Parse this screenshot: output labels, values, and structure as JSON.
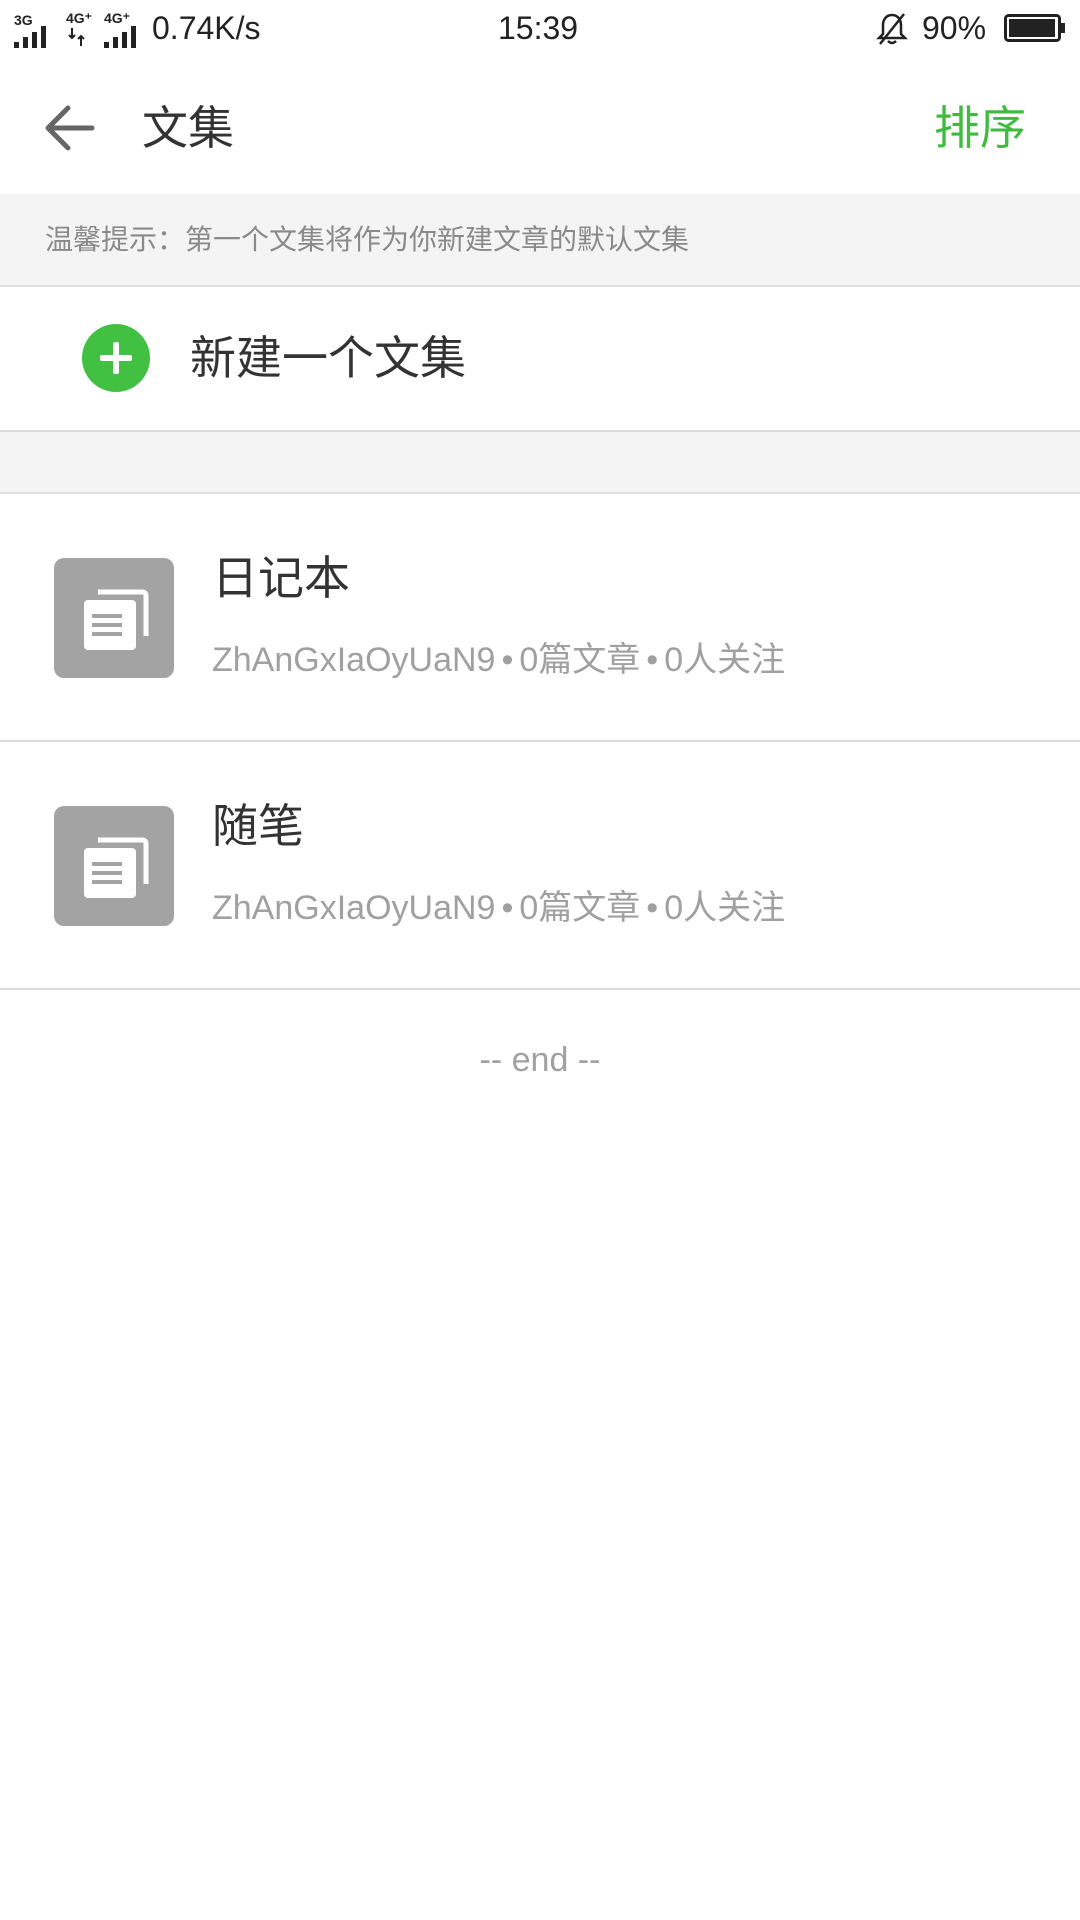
{
  "status_bar": {
    "network_label_1": "3G",
    "network_label_2": "4G⁺",
    "network_label_3": "4G⁺",
    "speed": "0.74K/s",
    "time": "15:39",
    "battery": "90%"
  },
  "header": {
    "title": "文集",
    "sort_label": "排序"
  },
  "tip": "温馨提示：第一个文集将作为你新建文章的默认文集",
  "new_collection_label": "新建一个文集",
  "collections": [
    {
      "title": "日记本",
      "author": "ZhAnGxIaOyUaN9",
      "articles": "0篇文章",
      "followers": "0人关注"
    },
    {
      "title": "随笔",
      "author": "ZhAnGxIaOyUaN9",
      "articles": "0篇文章",
      "followers": "0人关注"
    }
  ],
  "end_label": "-- end --",
  "colors": {
    "accent_green": "#3fbb3f",
    "icon_gray": "#a3a3a3"
  }
}
